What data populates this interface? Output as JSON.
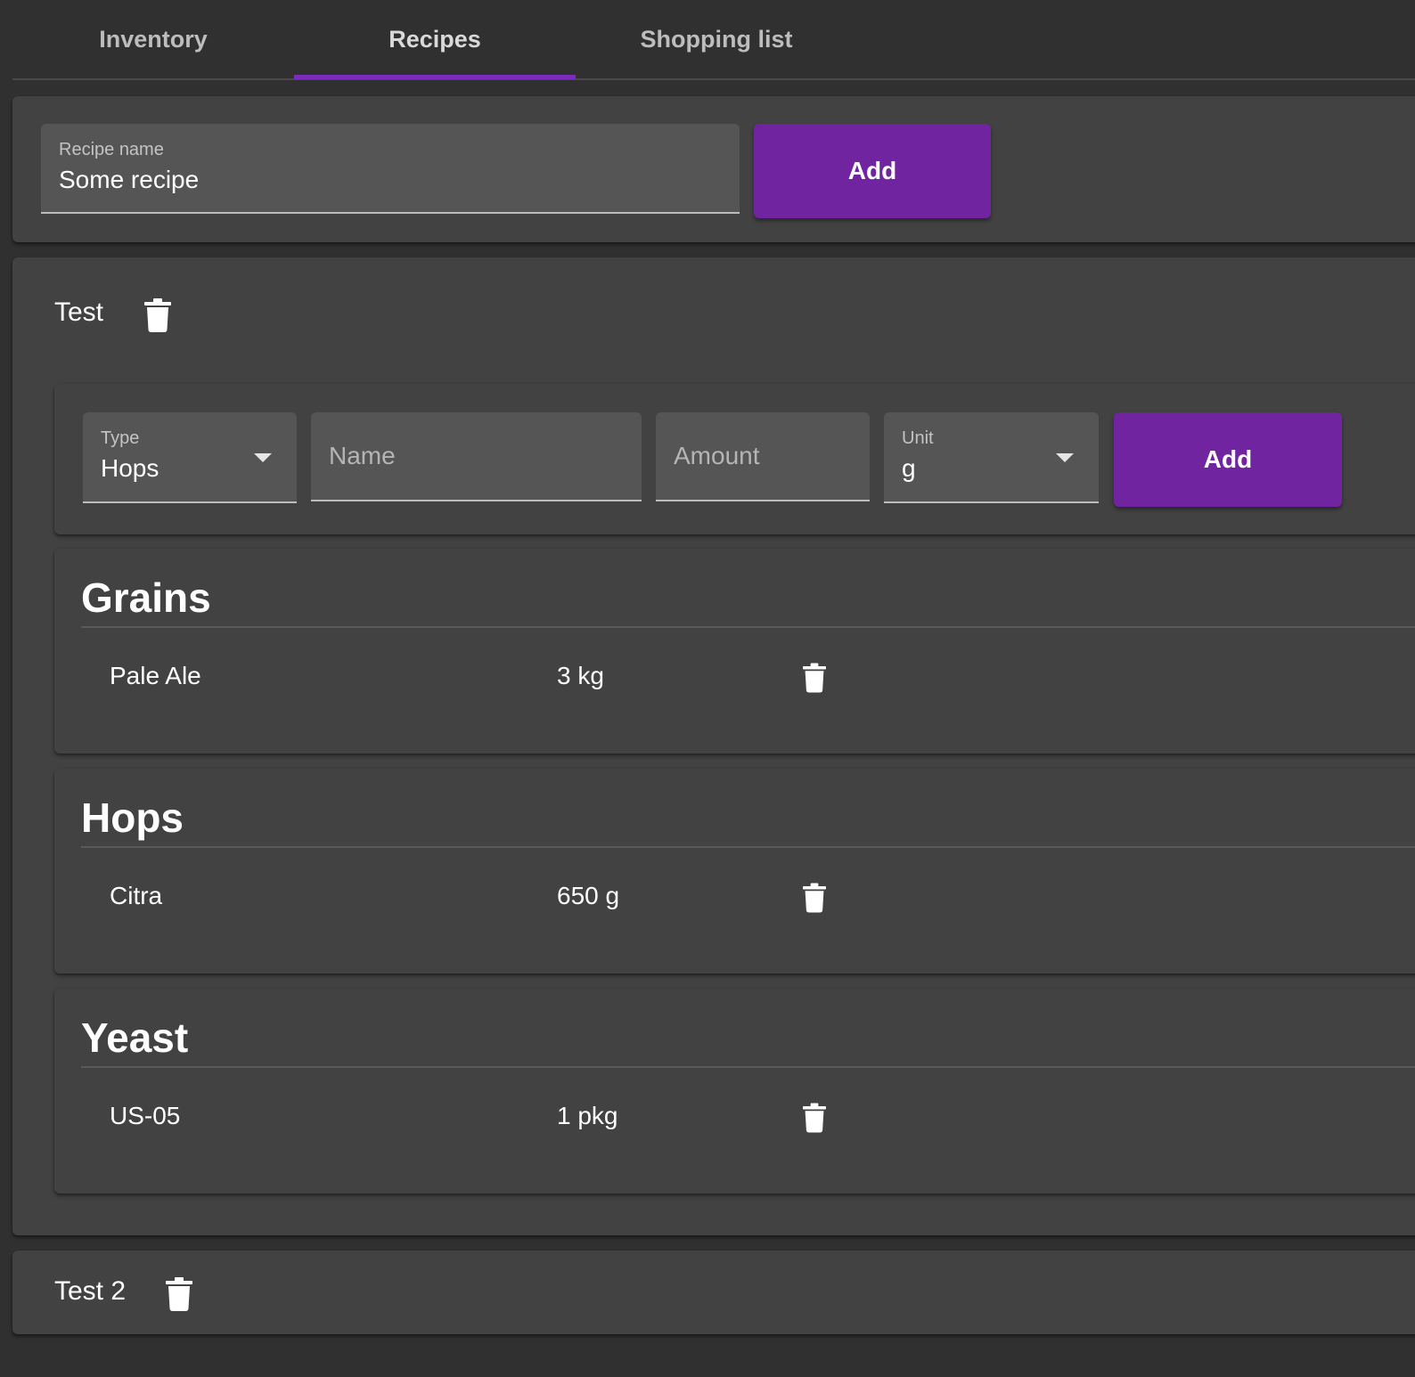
{
  "tabs": [
    {
      "label": "Inventory",
      "active": false
    },
    {
      "label": "Recipes",
      "active": true
    },
    {
      "label": "Shopping list",
      "active": false
    }
  ],
  "accent_color": "#7124a0",
  "new_recipe": {
    "label": "Recipe name",
    "value": "Some recipe",
    "add_label": "Add"
  },
  "recipes": [
    {
      "title": "Test",
      "expanded": true,
      "ingredient_form": {
        "type_label": "Type",
        "type_value": "Hops",
        "name_placeholder": "Name",
        "amount_placeholder": "Amount",
        "unit_label": "Unit",
        "unit_value": "g",
        "add_label": "Add"
      },
      "sections": [
        {
          "title": "Grains",
          "items": [
            {
              "name": "Pale Ale",
              "amount": "3 kg"
            }
          ]
        },
        {
          "title": "Hops",
          "items": [
            {
              "name": "Citra",
              "amount": "650 g"
            }
          ]
        },
        {
          "title": "Yeast",
          "items": [
            {
              "name": "US-05",
              "amount": "1 pkg"
            }
          ]
        }
      ]
    },
    {
      "title": "Test 2",
      "expanded": false
    }
  ]
}
